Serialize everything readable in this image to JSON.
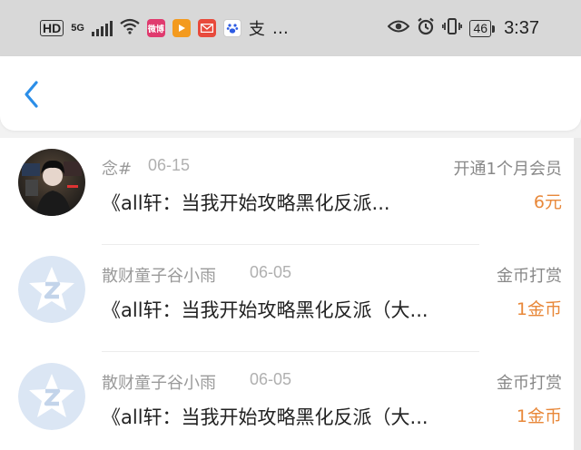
{
  "status_bar": {
    "hd": "HD",
    "network": "5G",
    "carrier_app_text": "微博",
    "overflow": "…",
    "battery": "46",
    "time": "3:37",
    "icons": [
      "signal-icon",
      "wifi-icon",
      "app-icon",
      "video-icon",
      "mail-icon",
      "baidu-icon",
      "alipay-icon",
      "eye-icon",
      "alarm-icon",
      "vibrate-icon",
      "battery-icon"
    ]
  },
  "header": {
    "back_icon": "chevron-left-icon",
    "accent": "#2b8ee8"
  },
  "records": [
    {
      "user": "念#",
      "date": "06-15",
      "type": "开通1个月会员",
      "title": "《all轩：当我开始攻略黑化反派...",
      "amount": "6元",
      "avatar": "photo"
    },
    {
      "user": "散财童子谷小雨",
      "date": "06-05",
      "type": "金币打赏",
      "title": "《all轩：当我开始攻略黑化反派（大...",
      "amount": "1金币",
      "avatar": "default"
    },
    {
      "user": "散财童子谷小雨",
      "date": "06-05",
      "type": "金币打赏",
      "title": "《all轩：当我开始攻略黑化反派（大...",
      "amount": "1金币",
      "avatar": "default"
    }
  ],
  "colors": {
    "amount": "#e8883a",
    "meta": "#9a9a9a",
    "title": "#222222"
  }
}
